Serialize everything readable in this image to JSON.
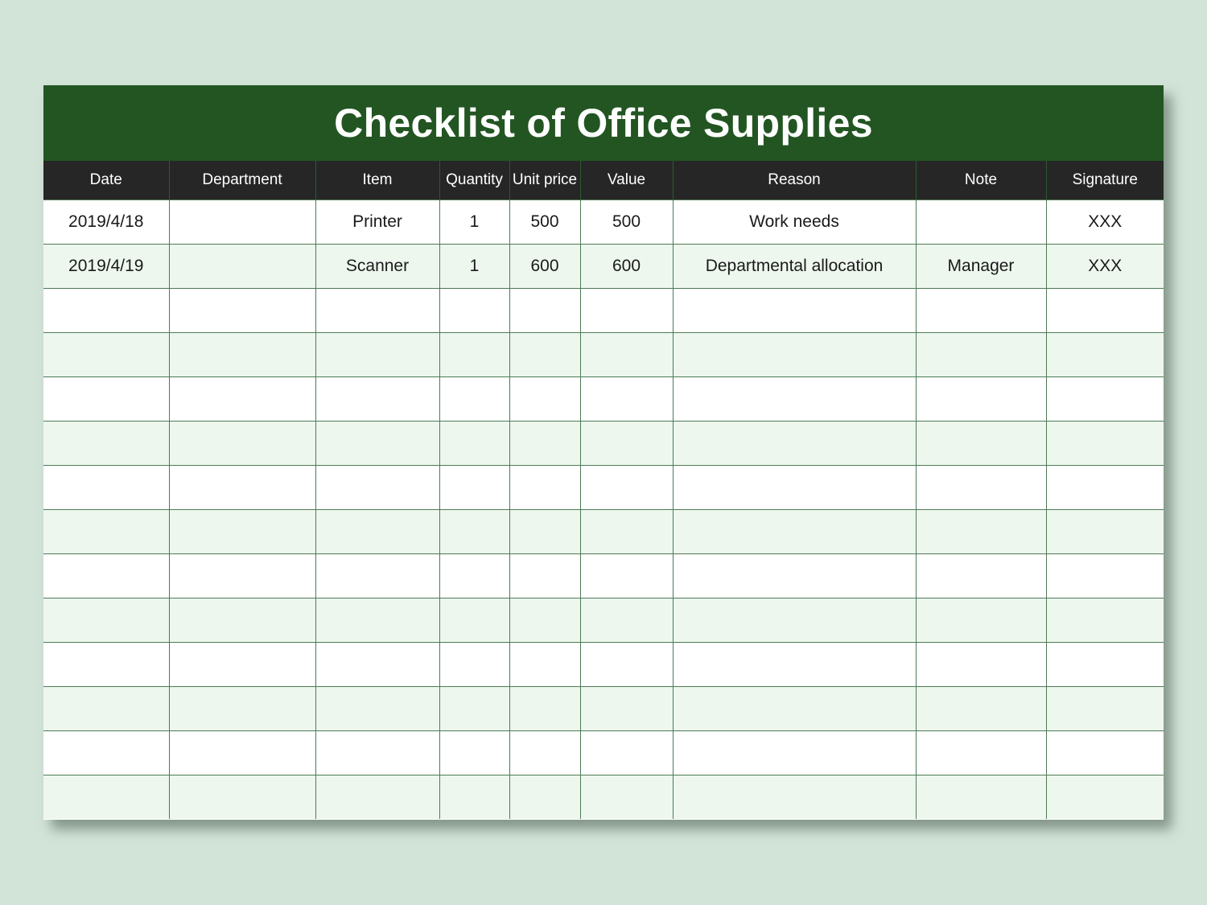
{
  "title": "Checklist of Office Supplies",
  "colors": {
    "title_bg": "#225522",
    "header_bg": "#262626",
    "row_alt_bg": "#edf7ee",
    "page_bg": "#d2e3d8",
    "grid": "#4e7a55"
  },
  "columns": [
    "Date",
    "Department",
    "Item",
    "Quantity",
    "Unit price",
    "Value",
    "Reason",
    "Note",
    "Signature"
  ],
  "rows": [
    [
      "2019/4/18",
      "",
      "Printer",
      "1",
      "500",
      "500",
      "Work needs",
      "",
      "XXX"
    ],
    [
      "2019/4/19",
      "",
      "Scanner",
      "1",
      "600",
      "600",
      "Departmental allocation",
      "Manager",
      "XXX"
    ],
    [
      "",
      "",
      "",
      "",
      "",
      "",
      "",
      "",
      ""
    ],
    [
      "",
      "",
      "",
      "",
      "",
      "",
      "",
      "",
      ""
    ],
    [
      "",
      "",
      "",
      "",
      "",
      "",
      "",
      "",
      ""
    ],
    [
      "",
      "",
      "",
      "",
      "",
      "",
      "",
      "",
      ""
    ],
    [
      "",
      "",
      "",
      "",
      "",
      "",
      "",
      "",
      ""
    ],
    [
      "",
      "",
      "",
      "",
      "",
      "",
      "",
      "",
      ""
    ],
    [
      "",
      "",
      "",
      "",
      "",
      "",
      "",
      "",
      ""
    ],
    [
      "",
      "",
      "",
      "",
      "",
      "",
      "",
      "",
      ""
    ],
    [
      "",
      "",
      "",
      "",
      "",
      "",
      "",
      "",
      ""
    ],
    [
      "",
      "",
      "",
      "",
      "",
      "",
      "",
      "",
      ""
    ],
    [
      "",
      "",
      "",
      "",
      "",
      "",
      "",
      "",
      ""
    ],
    [
      "",
      "",
      "",
      "",
      "",
      "",
      "",
      "",
      ""
    ]
  ]
}
